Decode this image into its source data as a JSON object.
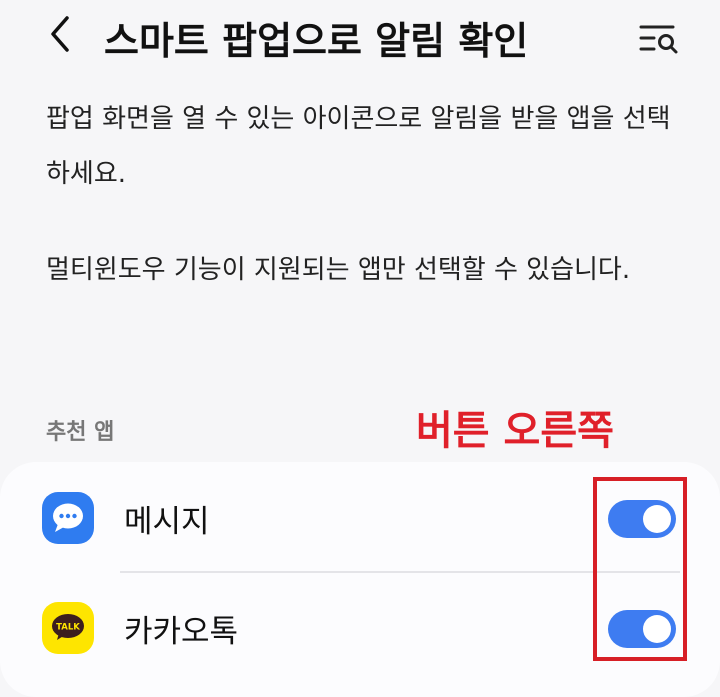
{
  "header": {
    "title": "스마트 팝업으로 알림 확인",
    "back_icon": "chevron-left-icon",
    "search_icon": "list-search-icon"
  },
  "description": {
    "line1": "팝업 화면을 열 수 있는 아이콘으로 알림을 받을 앱을 선택하세요.",
    "line2": "멀티윈도우 기능이 지원되는 앱만 선택할 수 있습니다."
  },
  "section": {
    "label": "추천 앱"
  },
  "annotation": {
    "text": "버튼 오른쪽",
    "color": "#e0202a"
  },
  "apps": [
    {
      "name": "메시지",
      "icon": "messages-icon",
      "enabled": true
    },
    {
      "name": "카카오톡",
      "icon": "kakaotalk-icon",
      "icon_text": "TALK",
      "enabled": true
    }
  ],
  "colors": {
    "toggle_on": "#3e7cf1",
    "messages_icon": "#2f7cf0",
    "kakao_icon": "#fee500",
    "highlight_border": "#d71f26"
  }
}
